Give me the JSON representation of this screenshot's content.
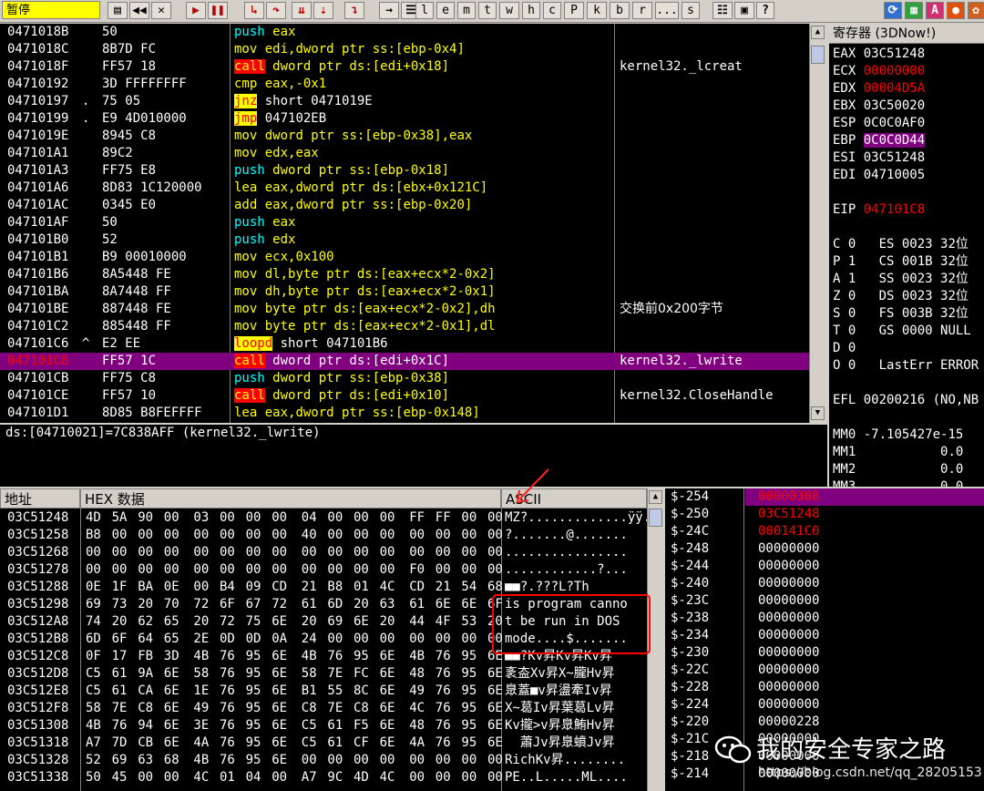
{
  "toolbar": {
    "status": "暂停",
    "buttons": [
      "l",
      "e",
      "m",
      "t",
      "w",
      "h",
      "c",
      "P",
      "k",
      "b",
      "r",
      "...",
      "s"
    ]
  },
  "disasm": [
    {
      "addr": "0471018B",
      "mark": "",
      "hex": "50",
      "dis": [
        {
          "t": "push",
          "c": "kw-push"
        },
        {
          "t": " eax",
          "c": "op"
        }
      ],
      "com": ""
    },
    {
      "addr": "0471018C",
      "mark": "",
      "hex": "8B7D FC",
      "dis": [
        {
          "t": "mov",
          "c": "kw-mov"
        },
        {
          "t": " edi,dword ptr ss:[ebp-0x4]",
          "c": "op"
        }
      ],
      "com": ""
    },
    {
      "addr": "0471018F",
      "mark": "",
      "hex": "FF57 18",
      "dis": [
        {
          "t": "call",
          "c": "hl-red"
        },
        {
          "t": " dword ptr ds:[edi+0x18]",
          "c": "op"
        }
      ],
      "com": "kernel32._lcreat"
    },
    {
      "addr": "04710192",
      "mark": "",
      "hex": "3D FFFFFFFF",
      "dis": [
        {
          "t": "cmp",
          "c": "kw-cmp"
        },
        {
          "t": " eax,",
          "c": "op"
        },
        {
          "t": "-0x1",
          "c": "num"
        }
      ],
      "com": ""
    },
    {
      "addr": "04710197",
      "mark": ".",
      "hex": "75 05",
      "dis": [
        {
          "t": "jnz",
          "c": "hl-yel"
        },
        {
          "t": " short 0471019E",
          "c": "opw"
        }
      ],
      "com": ""
    },
    {
      "addr": "04710199",
      "mark": ".",
      "hex": "E9 4D010000",
      "dis": [
        {
          "t": "jmp",
          "c": "hl-yel"
        },
        {
          "t": " 047102EB",
          "c": "opw"
        }
      ],
      "com": ""
    },
    {
      "addr": "0471019E",
      "mark": "",
      "hex": "8945 C8",
      "dis": [
        {
          "t": "mov",
          "c": "kw-mov"
        },
        {
          "t": " dword ptr ss:[ebp-0x38],eax",
          "c": "op"
        }
      ],
      "com": ""
    },
    {
      "addr": "047101A1",
      "mark": "",
      "hex": "89C2",
      "dis": [
        {
          "t": "mov",
          "c": "kw-mov"
        },
        {
          "t": " edx,eax",
          "c": "op"
        }
      ],
      "com": ""
    },
    {
      "addr": "047101A3",
      "mark": "",
      "hex": "FF75 E8",
      "dis": [
        {
          "t": "push",
          "c": "kw-push"
        },
        {
          "t": " dword ptr ss:[ebp-0x18]",
          "c": "op"
        }
      ],
      "com": ""
    },
    {
      "addr": "047101A6",
      "mark": "",
      "hex": "8D83 1C120000",
      "dis": [
        {
          "t": "lea",
          "c": "kw-lea"
        },
        {
          "t": " eax,dword ptr ds:[ebx+0x121C]",
          "c": "op"
        }
      ],
      "com": ""
    },
    {
      "addr": "047101AC",
      "mark": "",
      "hex": "0345 E0",
      "dis": [
        {
          "t": "add",
          "c": "kw-add"
        },
        {
          "t": " eax,dword ptr ss:[ebp-0x20]",
          "c": "op"
        }
      ],
      "com": ""
    },
    {
      "addr": "047101AF",
      "mark": "",
      "hex": "50",
      "dis": [
        {
          "t": "push",
          "c": "kw-push"
        },
        {
          "t": " eax",
          "c": "op"
        }
      ],
      "com": ""
    },
    {
      "addr": "047101B0",
      "mark": "",
      "hex": "52",
      "dis": [
        {
          "t": "push",
          "c": "kw-push"
        },
        {
          "t": " edx",
          "c": "op"
        }
      ],
      "com": ""
    },
    {
      "addr": "047101B1",
      "mark": "",
      "hex": "B9 00010000",
      "dis": [
        {
          "t": "mov",
          "c": "kw-mov"
        },
        {
          "t": " ecx,",
          "c": "op"
        },
        {
          "t": "0x100",
          "c": "num"
        }
      ],
      "com": ""
    },
    {
      "addr": "047101B6",
      "mark": "",
      "hex": "8A5448 FE",
      "dis": [
        {
          "t": "mov",
          "c": "kw-mov"
        },
        {
          "t": " dl,byte ptr ds:[eax+ecx*2-0x2]",
          "c": "op"
        }
      ],
      "com": ""
    },
    {
      "addr": "047101BA",
      "mark": "",
      "hex": "8A7448 FF",
      "dis": [
        {
          "t": "mov",
          "c": "kw-mov"
        },
        {
          "t": " dh,byte ptr ds:[eax+ecx*2-0x1]",
          "c": "op"
        }
      ],
      "com": ""
    },
    {
      "addr": "047101BE",
      "mark": "",
      "hex": "887448 FE",
      "dis": [
        {
          "t": "mov",
          "c": "kw-mov"
        },
        {
          "t": " byte ptr ds:[eax+ecx*2-0x2],dh",
          "c": "op"
        }
      ],
      "com": "交换前0x200字节"
    },
    {
      "addr": "047101C2",
      "mark": "",
      "hex": "885448 FF",
      "dis": [
        {
          "t": "mov",
          "c": "kw-mov"
        },
        {
          "t": " byte ptr ds:[eax+ecx*2-0x1],dl",
          "c": "op"
        }
      ],
      "com": ""
    },
    {
      "addr": "047101C6",
      "mark": "^",
      "hex": "E2 EE",
      "dis": [
        {
          "t": "loopd",
          "c": "hl-yel"
        },
        {
          "t": " short 047101B6",
          "c": "opw"
        }
      ],
      "com": ""
    },
    {
      "addr": "047101C8",
      "mark": "",
      "hex": "FF57 1C",
      "dis": [
        {
          "t": "call",
          "c": "hl-red"
        },
        {
          "t": " dword ptr ds:[edi+0x1C]",
          "c": "op"
        }
      ],
      "com": "kernel32._lwrite",
      "sel": true
    },
    {
      "addr": "047101CB",
      "mark": "",
      "hex": "FF75 C8",
      "dis": [
        {
          "t": "push",
          "c": "kw-push"
        },
        {
          "t": " dword ptr ss:[ebp-0x38]",
          "c": "op"
        }
      ],
      "com": ""
    },
    {
      "addr": "047101CE",
      "mark": "",
      "hex": "FF57 10",
      "dis": [
        {
          "t": "call",
          "c": "hl-red"
        },
        {
          "t": " dword ptr ds:[edi+0x10]",
          "c": "op"
        }
      ],
      "com": "kernel32.CloseHandle"
    },
    {
      "addr": "047101D1",
      "mark": "",
      "hex": "8D85 B8FEFFFF",
      "dis": [
        {
          "t": "lea",
          "c": "kw-lea"
        },
        {
          "t": " eax,dword ptr ss:[ebp-0x148]",
          "c": "op"
        }
      ],
      "com": ""
    }
  ],
  "info_line": "ds:[04710021]=7C838AFF (kernel32._lwrite)",
  "registers": {
    "title": "寄存器 (3DNow!)",
    "rows": [
      {
        "name": "EAX",
        "val": "03C51248",
        "style": ""
      },
      {
        "name": "ECX",
        "val": "00000000",
        "style": "red"
      },
      {
        "name": "EDX",
        "val": "00004D5A",
        "style": "red"
      },
      {
        "name": "EBX",
        "val": "03C50020",
        "style": ""
      },
      {
        "name": "ESP",
        "val": "0C0C0AF0",
        "style": ""
      },
      {
        "name": "EBP",
        "val": "0C0C0D44",
        "style": "selv"
      },
      {
        "name": "ESI",
        "val": "03C51248",
        "style": ""
      },
      {
        "name": "EDI",
        "val": "04710005",
        "style": ""
      },
      {
        "name": "",
        "val": "",
        "style": ""
      },
      {
        "name": "EIP",
        "val": "047101C8",
        "style": "red"
      },
      {
        "name": "",
        "val": "",
        "style": ""
      },
      {
        "name": "C 0",
        "val": "  ES 0023 32位",
        "style": ""
      },
      {
        "name": "P 1",
        "val": "  CS 001B 32位",
        "style": ""
      },
      {
        "name": "A 1",
        "val": "  SS 0023 32位",
        "style": ""
      },
      {
        "name": "Z 0",
        "val": "  DS 0023 32位",
        "style": ""
      },
      {
        "name": "S 0",
        "val": "  FS 003B 32位",
        "style": ""
      },
      {
        "name": "T 0",
        "val": "  GS 0000 NULL",
        "style": ""
      },
      {
        "name": "D 0",
        "val": "",
        "style": ""
      },
      {
        "name": "O 0",
        "val": "  LastErr ERROR",
        "style": ""
      },
      {
        "name": "",
        "val": "",
        "style": ""
      },
      {
        "name": "EFL",
        "val": "00200216 (NO,NB",
        "style": ""
      },
      {
        "name": "",
        "val": "",
        "style": ""
      },
      {
        "name": "MM0",
        "val": "-7.105427e-15",
        "style": ""
      },
      {
        "name": "MM1",
        "val": "          0.0",
        "style": ""
      },
      {
        "name": "MM2",
        "val": "          0.0",
        "style": ""
      },
      {
        "name": "MM3",
        "val": "          0.0",
        "style": ""
      },
      {
        "name": "MM4",
        "val": "          0.0",
        "style": ""
      }
    ]
  },
  "dump": {
    "header_addr": "地址",
    "header_hex": "HEX 数据",
    "header_ascii": "ASCII",
    "rows": [
      {
        "addr": "03C51248",
        "bytes": [
          "4D",
          "5A",
          "90",
          "00",
          "03",
          "00",
          "00",
          "00",
          "04",
          "00",
          "00",
          "00",
          "FF",
          "FF",
          "00",
          "00"
        ],
        "ascii": "MZ?.............ÿÿ.."
      },
      {
        "addr": "03C51258",
        "bytes": [
          "B8",
          "00",
          "00",
          "00",
          "00",
          "00",
          "00",
          "00",
          "40",
          "00",
          "00",
          "00",
          "00",
          "00",
          "00",
          "00"
        ],
        "ascii": "?.......@......."
      },
      {
        "addr": "03C51268",
        "bytes": [
          "00",
          "00",
          "00",
          "00",
          "00",
          "00",
          "00",
          "00",
          "00",
          "00",
          "00",
          "00",
          "00",
          "00",
          "00",
          "00"
        ],
        "ascii": "................"
      },
      {
        "addr": "03C51278",
        "bytes": [
          "00",
          "00",
          "00",
          "00",
          "00",
          "00",
          "00",
          "00",
          "00",
          "00",
          "00",
          "00",
          "F0",
          "00",
          "00",
          "00"
        ],
        "ascii": "............?..."
      },
      {
        "addr": "03C51288",
        "bytes": [
          "0E",
          "1F",
          "BA",
          "0E",
          "00",
          "B4",
          "09",
          "CD",
          "21",
          "B8",
          "01",
          "4C",
          "CD",
          "21",
          "54",
          "68"
        ],
        "ascii": "■■?.???L?Th"
      },
      {
        "addr": "03C51298",
        "bytes": [
          "69",
          "73",
          "20",
          "70",
          "72",
          "6F",
          "67",
          "72",
          "61",
          "6D",
          "20",
          "63",
          "61",
          "6E",
          "6E",
          "6F"
        ],
        "ascii": "is program canno"
      },
      {
        "addr": "03C512A8",
        "bytes": [
          "74",
          "20",
          "62",
          "65",
          "20",
          "72",
          "75",
          "6E",
          "20",
          "69",
          "6E",
          "20",
          "44",
          "4F",
          "53",
          "20"
        ],
        "ascii": "t be run in DOS "
      },
      {
        "addr": "03C512B8",
        "bytes": [
          "6D",
          "6F",
          "64",
          "65",
          "2E",
          "0D",
          "0D",
          "0A",
          "24",
          "00",
          "00",
          "00",
          "00",
          "00",
          "00",
          "00"
        ],
        "ascii": "mode....$......."
      },
      {
        "addr": "03C512C8",
        "bytes": [
          "0F",
          "17",
          "FB",
          "3D",
          "4B",
          "76",
          "95",
          "6E",
          "4B",
          "76",
          "95",
          "6E",
          "4B",
          "76",
          "95",
          "6E"
        ],
        "ascii": "■■?Kv昇Kv昇Kv昇"
      },
      {
        "addr": "03C512D8",
        "bytes": [
          "C5",
          "61",
          "9A",
          "6E",
          "58",
          "76",
          "95",
          "6E",
          "58",
          "7E",
          "FC",
          "6E",
          "48",
          "76",
          "95",
          "6E"
        ],
        "ascii": "袲盇Xv昇X~朧Hv昇"
      },
      {
        "addr": "03C512E8",
        "bytes": [
          "C5",
          "61",
          "CA",
          "6E",
          "1E",
          "76",
          "95",
          "6E",
          "B1",
          "55",
          "8C",
          "6E",
          "49",
          "76",
          "95",
          "6E"
        ],
        "ascii": "臮蓋■v昇盪牽Iv昇"
      },
      {
        "addr": "03C512F8",
        "bytes": [
          "58",
          "7E",
          "C8",
          "6E",
          "49",
          "76",
          "95",
          "6E",
          "C8",
          "7E",
          "C8",
          "6E",
          "4C",
          "76",
          "95",
          "6E"
        ],
        "ascii": "X~葛Iv昇葉葛Lv昇"
      },
      {
        "addr": "03C51308",
        "bytes": [
          "4B",
          "76",
          "94",
          "6E",
          "3E",
          "76",
          "95",
          "6E",
          "C5",
          "61",
          "F5",
          "6E",
          "48",
          "76",
          "95",
          "6E"
        ],
        "ascii": "Kv攏>v昇臮鮪Hv昇"
      },
      {
        "addr": "03C51318",
        "bytes": [
          "A7",
          "7D",
          "CB",
          "6E",
          "4A",
          "76",
          "95",
          "6E",
          "C5",
          "61",
          "CF",
          "6E",
          "4A",
          "76",
          "95",
          "6E"
        ],
        "ascii": "  蕭Jv昇臮蟦Jv昇"
      },
      {
        "addr": "03C51328",
        "bytes": [
          "52",
          "69",
          "63",
          "68",
          "4B",
          "76",
          "95",
          "6E",
          "00",
          "00",
          "00",
          "00",
          "00",
          "00",
          "00",
          "00"
        ],
        "ascii": "RichKv昇........"
      },
      {
        "addr": "03C51338",
        "bytes": [
          "50",
          "45",
          "00",
          "00",
          "4C",
          "01",
          "04",
          "00",
          "A7",
          "9C",
          "4D",
          "4C",
          "00",
          "00",
          "00",
          "00"
        ],
        "ascii": "PE..L.....ML...."
      }
    ]
  },
  "stack": [
    {
      "off": "$-254",
      "val": "00000308",
      "style": "selrow"
    },
    {
      "off": "$-250",
      "val": "03C51248",
      "style": "red"
    },
    {
      "off": "$-24C",
      "val": "000141C0",
      "style": "red"
    },
    {
      "off": "$-248",
      "val": "00000000",
      "style": ""
    },
    {
      "off": "$-244",
      "val": "00000000",
      "style": ""
    },
    {
      "off": "$-240",
      "val": "00000000",
      "style": ""
    },
    {
      "off": "$-23C",
      "val": "00000000",
      "style": ""
    },
    {
      "off": "$-238",
      "val": "00000000",
      "style": ""
    },
    {
      "off": "$-234",
      "val": "00000000",
      "style": ""
    },
    {
      "off": "$-230",
      "val": "00000000",
      "style": ""
    },
    {
      "off": "$-22C",
      "val": "00000000",
      "style": ""
    },
    {
      "off": "$-228",
      "val": "00000000",
      "style": ""
    },
    {
      "off": "$-224",
      "val": "00000000",
      "style": ""
    },
    {
      "off": "$-220",
      "val": "00000228",
      "style": ""
    },
    {
      "off": "$-21C",
      "val": "00000000",
      "style": ""
    },
    {
      "off": "$-218",
      "val": "00000000",
      "style": ""
    },
    {
      "off": "$-214",
      "val": "00000000",
      "style": ""
    }
  ],
  "watermark": {
    "title": "我的安全专家之路",
    "url": "https://blog.csdn.net/qq_28205153"
  },
  "colors": {
    "selection": "#800080",
    "accent_red": "#ff0000",
    "accent_yellow": "#ffff00",
    "cyan": "#00ffff"
  }
}
